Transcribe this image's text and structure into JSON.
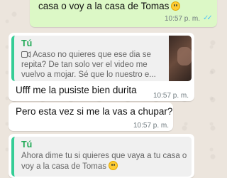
{
  "messages": [
    {
      "text": "casa o voy a la casa de Tomas",
      "time": "10:57 p. m."
    },
    {
      "quote_author": "Tú",
      "quote_lines": [
        "Acaso no quieres que ese dia se",
        "repita? De tan solo ver el video me",
        "vuelvo a mojar. Sé que lo nuestro e..."
      ],
      "text": "Ufff me la pusiste bien durita",
      "time": "10:57 p. m."
    },
    {
      "text": "Pero esta vez si me la vas a chupar?",
      "time": "10:57 p. m."
    },
    {
      "quote_author": "Tú",
      "quote_lines": [
        "Ahora dime tu si quieres que vaya a tu casa o",
        "voy a la casa de Tomas"
      ]
    }
  ],
  "icons": {
    "read_receipt": "double-check-icon",
    "emoji": "smiling-face-icon",
    "video": "video-camera-icon"
  },
  "colors": {
    "outgoing_bubble": "#dcf8c6",
    "incoming_bubble": "#ffffff",
    "quote_bar": "#35cd96",
    "quote_author": "#1fa855",
    "read_ticks": "#4fc3f7",
    "wallpaper": "#ece5dd"
  }
}
